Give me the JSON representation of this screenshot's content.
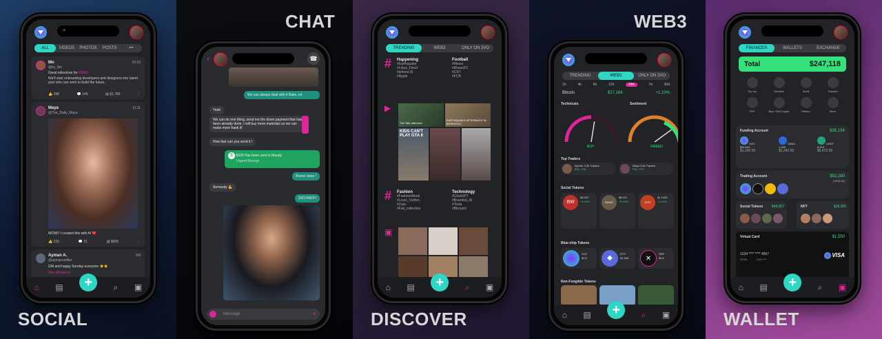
{
  "captions": {
    "social": "SOCIAL",
    "chat": "CHAT",
    "discover": "DISCOVER",
    "web3": "WEB3",
    "wallet": "WALLET"
  },
  "social": {
    "tabs": [
      "ALL",
      "VIDEOS",
      "PHOTOS",
      "POSTS",
      "•••"
    ],
    "post1": {
      "name": "Mo",
      "handle": "@by_Mo",
      "time": "10:10",
      "text1": "Great milestone for",
      "brand": "WEB3",
      "text2": "We'll start onboarding developers and designers into talent pool who can work to build the future.",
      "likes": "398",
      "comments": "145",
      "views": "$1,786"
    },
    "post2": {
      "name": "Maya",
      "handle": "@The_Daily_Maya",
      "time": "11:11",
      "caption": "WOW!! I created this with AI ❤️",
      "likes": "233",
      "comments": "21",
      "views": "$805"
    },
    "post3": {
      "name": "Ayman A.",
      "handle": "@aymanowflier",
      "time": "9/9",
      "text": "GM and happy Sunday everyone ☀️☀️",
      "link": "Vibe Weekend"
    }
  },
  "chat": {
    "msg1": "We can always deal with it Bake, lol",
    "msg2": "Yeah",
    "msg3": "We can do one thing, send me the down payment that has been already done, I will buy more materials so we can make more frank it!",
    "msg4": "How fast can you send it !",
    "msg5": "$600 Has been sent to Mandy",
    "msg5b": "Urgent Receipt",
    "msg6": "Boom! done !",
    "msg7": "Seriously 💪",
    "msg8": "3VO RAD!!!",
    "input_placeholder": "Message"
  },
  "discover": {
    "tabs": [
      "TRENDING",
      "WEB3",
      "ONLY ON 3VO"
    ],
    "happening": {
      "title": "Happening",
      "items": [
        "#Earthquake",
        "#Libya_Flood",
        "#iphone15",
        "#Apple"
      ]
    },
    "football": {
      "title": "Football",
      "items": [
        "#Messi",
        "#AhsanFC",
        "#CR7",
        "#FCB"
      ]
    },
    "fashion": {
      "title": "Fashion",
      "items": [
        "#FashionWeek",
        "#Louis_Vuitton",
        "#Zara",
        "#Fall_collection"
      ]
    },
    "technology": {
      "title": "Technology",
      "items": [
        "#ChatGPT",
        "#Branded_AI",
        "#Tesla",
        "#Blizzard"
      ]
    },
    "thumbs": [
      "The Tate Interview",
      "EARTHQUAKE AFTERMATH IN MOROCCO",
      "KIDS CAN'T PLAY GTA 6"
    ]
  },
  "web3": {
    "tabs": [
      "TRENDING",
      "WEB3",
      "ONLY ON 3VO"
    ],
    "ranges": [
      "1h",
      "4h",
      "6h",
      "12h",
      "24h",
      "7d",
      "30d"
    ],
    "active_range": "24h",
    "btc": {
      "label": "Bitcoin",
      "price": "$27,184",
      "change": "+1.10%"
    },
    "technicals": {
      "title": "Technicals",
      "value": "BUY",
      "needle": 0.55
    },
    "sentiment": {
      "title": "Sentiment",
      "value": "GREED",
      "needle": 0.8
    },
    "top_traders_title": "Top Traders",
    "traders": [
      {
        "name": "Ayman",
        "meta": "3.3k Traders",
        "pnl": "PnL +7%"
      },
      {
        "name": "Maya",
        "meta": "3.6k Traders",
        "pnl": "PnL +7%"
      }
    ],
    "social_tokens_title": "Social Tokens",
    "social_tokens": [
      {
        "sym": "BW",
        "price": "$8.391",
        "chg": "+3.21%"
      },
      {
        "sym": "SAHIC",
        "price": "$8.191",
        "chg": "+5.21%"
      },
      {
        "sym": "ZTIIT",
        "price": "$1.1005",
        "chg": "+1.21%"
      }
    ],
    "bluechip_title": "Blue-chip Tokens",
    "bluechip": [
      {
        "sym": "3VO",
        "price": "$0.5",
        "chg": "+1.25%"
      },
      {
        "sym": "ETH",
        "price": "$1,583",
        "chg": "+1.25%"
      },
      {
        "sym": "XRP",
        "price": "$0.5",
        "chg": "+1.25%"
      }
    ],
    "nft_title": "Non-Fungible Tokens"
  },
  "wallet": {
    "tabs": [
      "FINANCES",
      "WALLETS",
      "EXCHANGE"
    ],
    "total_label": "Total",
    "total_value": "$247,118",
    "actions": [
      "Top Up",
      "Receive",
      "Send",
      "Transfer",
      "P2P",
      "Buy / Sell Crypto",
      "History",
      "More"
    ],
    "funding": {
      "title": "Funding Account",
      "value": "$35,156",
      "coins": [
        {
          "sym": "3VO",
          "amt": "$50,000",
          "sub": "$1,342.00"
        },
        {
          "sym": "USDC",
          "amt": "1,349",
          "sub": "$1,342.00"
        },
        {
          "sym": "USDT",
          "amt": "6,670",
          "sub": "$6,672.00"
        }
      ]
    },
    "trading": {
      "title": "Trading Account",
      "value": "$52,280",
      "sub": "(+$30.00)"
    },
    "social_tokens": {
      "title": "Social Tokens",
      "value": "$49,007"
    },
    "nft": {
      "title": "NFT",
      "value": "$10,355"
    },
    "card": {
      "title": "Virtual Card",
      "value": "$1,550",
      "number": "1234 **** **** 4567",
      "expiry": "07/29",
      "cvv": "CVV ***",
      "brand": "VISA"
    }
  }
}
